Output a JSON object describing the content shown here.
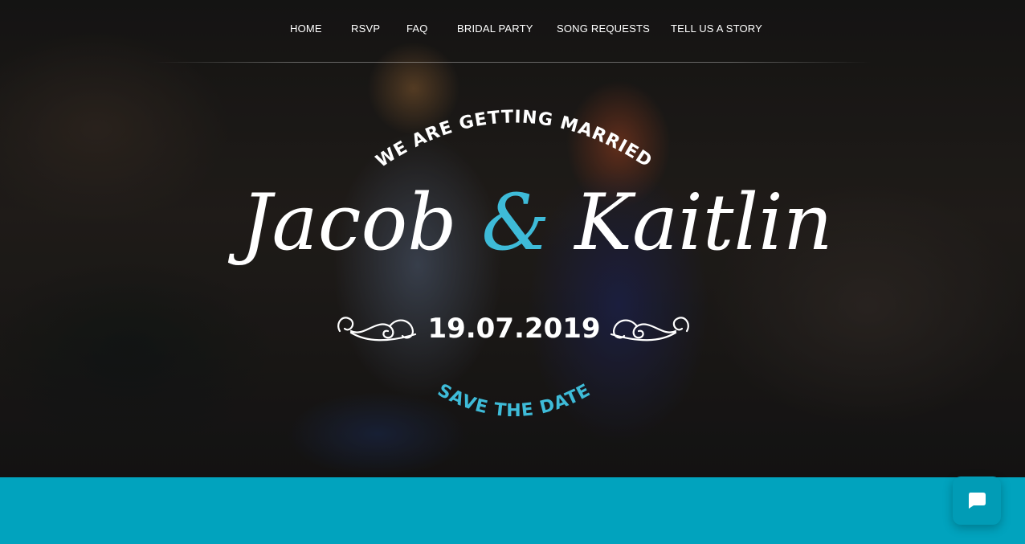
{
  "nav": {
    "items": [
      {
        "label": "HOME"
      },
      {
        "label": "RSVP"
      },
      {
        "label": "FAQ"
      },
      {
        "label": "BRIDAL PARTY"
      },
      {
        "label": "SONG REQUESTS"
      },
      {
        "label": "TELL US A STORY"
      }
    ]
  },
  "hero": {
    "top_arc_text": "WE ARE GETTING MARRIED",
    "groom_name": "Jacob",
    "ampersand": "&",
    "bride_name": "Kaitlin",
    "date": "19.07.2019",
    "bottom_arc_text": "SAVE THE DATE",
    "background": "engagement-photo-couple-sitting-on-rocks"
  },
  "chat": {
    "icon": "chat-bubble-icon"
  },
  "colors": {
    "accent": "#3ebbd8",
    "band": "#01a3be",
    "chat_button": "#019cb6",
    "text": "#ffffff"
  }
}
